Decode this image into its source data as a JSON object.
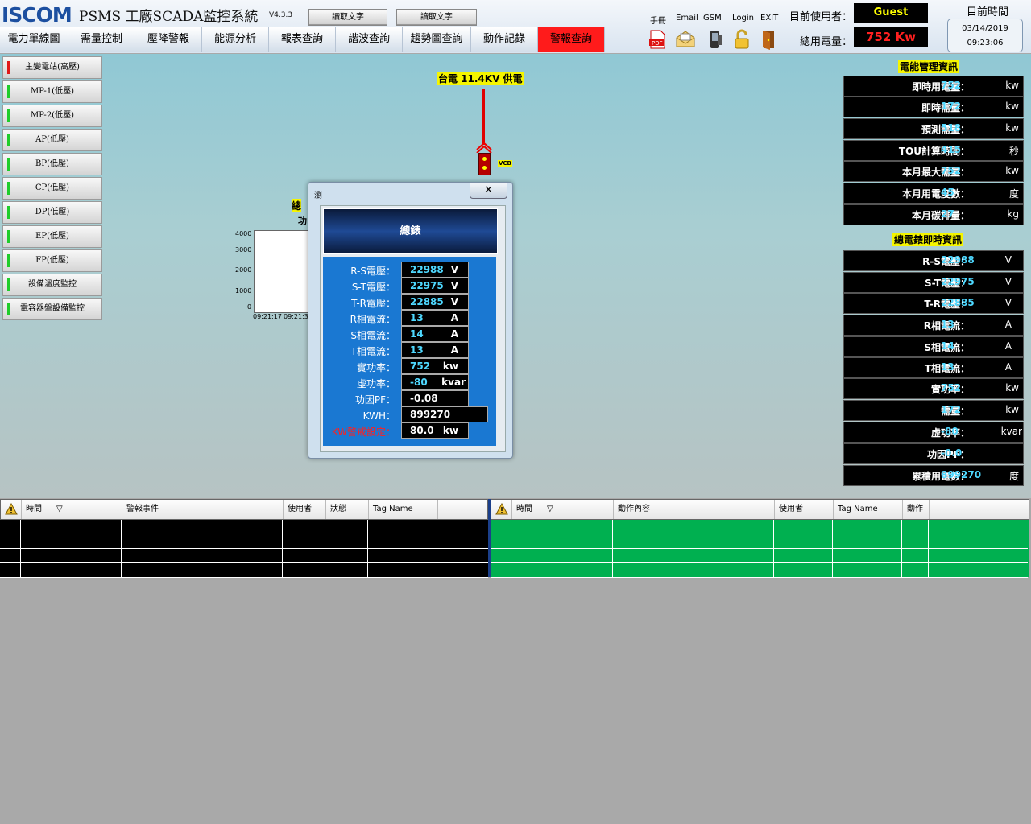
{
  "header": {
    "logo": "ISCOM",
    "title": "PSMS 工廠SCADA監控系統",
    "version": "V4.3.3",
    "read_btn_1": "讀取文字",
    "read_btn_2": "讀取文字",
    "links": [
      "手冊",
      "Email",
      "GSM",
      "Login",
      "EXIT"
    ],
    "current_user_label": "目前使用者：",
    "current_user": "Guest",
    "total_power_label": "總用電量：",
    "total_power": "752 Kw",
    "current_time_label": "目前時間",
    "date": "03/14/2019",
    "time": "09:23:06"
  },
  "nav": {
    "tabs": [
      "電力單線圖",
      "需量控制",
      "壓降警報",
      "能源分析",
      "報表查詢",
      "諧波查詢",
      "趨勢圖查詢",
      "動作記錄",
      "警報查詢"
    ]
  },
  "sidebar": {
    "items": [
      "主變電站(高壓)",
      "MP-1(低壓)",
      "MP-2(低壓)",
      "AP(低壓)",
      "BP(低壓)",
      "CP(低壓)",
      "DP(低壓)",
      "EP(低壓)",
      "FP(低壓)",
      "設備溫度監控",
      "電容器盤設備監控"
    ]
  },
  "diagram": {
    "supply_label": "台電 11.4KV 供電",
    "vcb_label": "VCB",
    "partial_label_1": "總",
    "partial_label_2": "功",
    "y_ticks": [
      "4000",
      "3000",
      "2000",
      "1000",
      "0"
    ],
    "x_ticks": [
      "09:21:17",
      "09:21:3"
    ]
  },
  "dialog": {
    "title": "瀏",
    "header": "總錶",
    "rows": [
      {
        "label": "R-S電壓：",
        "value": "22988",
        "unit": "V"
      },
      {
        "label": "S-T電壓：",
        "value": "22975",
        "unit": "V"
      },
      {
        "label": "T-R電壓：",
        "value": "22885",
        "unit": "V"
      },
      {
        "label": "R相電流：",
        "value": "13",
        "unit": "A"
      },
      {
        "label": "S相電流：",
        "value": "14",
        "unit": "A"
      },
      {
        "label": "T相電流：",
        "value": "13",
        "unit": "A"
      },
      {
        "label": "實功率：",
        "value": "752",
        "unit": "kw"
      },
      {
        "label": "虛功率：",
        "value": "-80",
        "unit": "kvar"
      },
      {
        "label": "功因PF：",
        "value": "-0.08",
        "unit": ""
      },
      {
        "label": "KWH：",
        "value": "899270",
        "unit": ""
      },
      {
        "label": "KW警戒設定：",
        "value": "80.0",
        "unit": "kw"
      }
    ]
  },
  "energy_panel": {
    "title": "電能管理資訊",
    "rows": [
      {
        "label": "即時用電量：",
        "value": "752",
        "unit": "kw"
      },
      {
        "label": "即時需量：",
        "value": "172",
        "unit": "kw"
      },
      {
        "label": "預測需量：",
        "value": "518",
        "unit": "kw"
      },
      {
        "label": "TOU計算時間：",
        "value": "415",
        "unit": "秒"
      },
      {
        "label": "本月最大需量：",
        "value": "752",
        "unit": "kw"
      },
      {
        "label": "本月用電度數：",
        "value": "45",
        "unit": "度"
      },
      {
        "label": "本月碳排量：",
        "value": "27",
        "unit": "kg"
      }
    ]
  },
  "meter_panel": {
    "title": "總電錶即時資訊",
    "rows": [
      {
        "label": "R-S電壓：",
        "value": "22988",
        "unit": "V"
      },
      {
        "label": "S-T電壓：",
        "value": "22975",
        "unit": "V"
      },
      {
        "label": "T-R電壓：",
        "value": "22885",
        "unit": "V"
      },
      {
        "label": "R相電流：",
        "value": "13",
        "unit": "A"
      },
      {
        "label": "S相電流：",
        "value": "14",
        "unit": "A"
      },
      {
        "label": "T相電流：",
        "value": "13",
        "unit": "A"
      },
      {
        "label": "實功率：",
        "value": "752",
        "unit": "kw"
      },
      {
        "label": "需量：",
        "value": "172",
        "unit": "kw"
      },
      {
        "label": "虛功率：",
        "value": "-80",
        "unit": "kvar"
      },
      {
        "label": "功因PF：",
        "value": "-0.0",
        "unit": ""
      },
      {
        "label": "累積用電數：",
        "value": "899270",
        "unit": "度"
      }
    ]
  },
  "alarm_table": {
    "columns": [
      "時間",
      "警報事件",
      "使用者",
      "狀態",
      "Tag Name",
      ""
    ]
  },
  "action_table": {
    "columns": [
      "時間",
      "動作內容",
      "使用者",
      "Tag Name",
      "動作",
      ""
    ]
  },
  "colors": {
    "alarm_tab": "#ff1b1b",
    "value_cyan": "#4ed8ff",
    "power_red": "#ff2020",
    "user_yellow": "#ffff00",
    "action_green": "#00b050"
  }
}
